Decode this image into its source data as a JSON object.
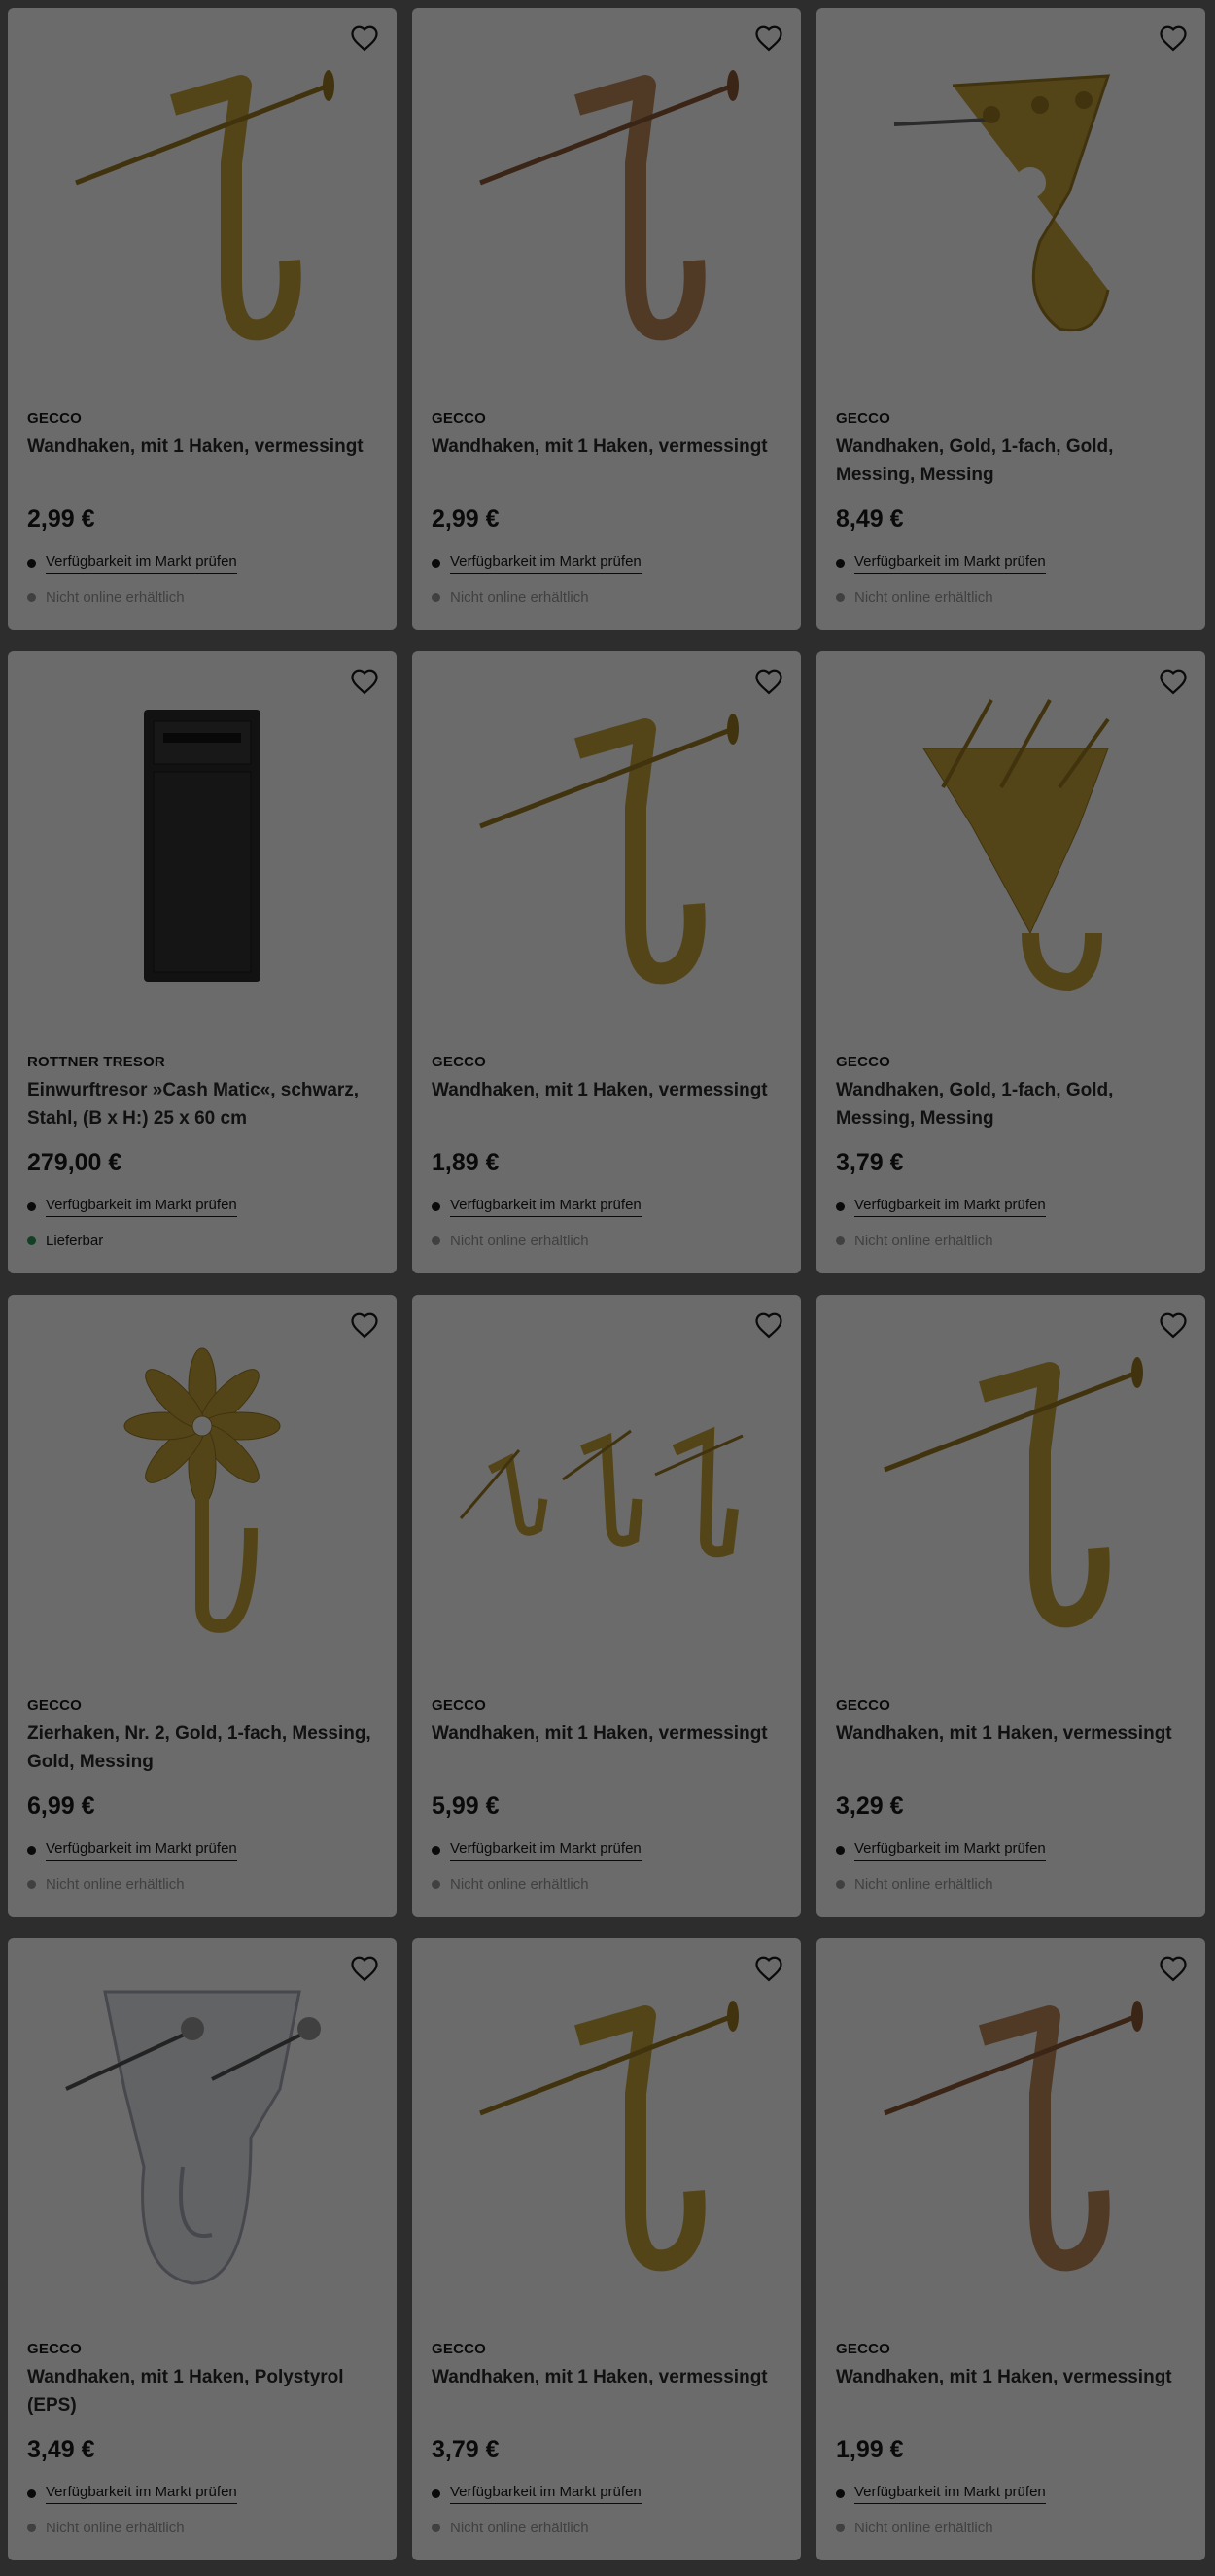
{
  "store_link_label": "Verfügbarkeit im Markt prüfen",
  "colors": {
    "unavailable": "#9a9a9a",
    "available": "#2e9a5a"
  },
  "products": [
    {
      "brand": "GECCO",
      "title": "Wandhaken, mit 1 Haken, vermessingt",
      "price": "2,99 €",
      "online": "Nicht online erhältlich",
      "available": false,
      "image": "hook-nail-brass"
    },
    {
      "brand": "GECCO",
      "title": "Wandhaken, mit 1 Haken, vermessingt",
      "price": "2,99 €",
      "online": "Nicht online erhältlich",
      "available": false,
      "image": "hook-nail-copper"
    },
    {
      "brand": "GECCO",
      "title": "Wandhaken, Gold, 1-fach, Gold, Messing, Messing",
      "price": "8,49 €",
      "online": "Nicht online erhältlich",
      "available": false,
      "image": "hook-plate-gold"
    },
    {
      "brand": "ROTTNER TRESOR",
      "title": "Einwurftresor »Cash Matic«, schwarz, Stahl, (B x H:) 25 x 60 cm",
      "price": "279,00 €",
      "online": "Lieferbar",
      "available": true,
      "image": "safe-black"
    },
    {
      "brand": "GECCO",
      "title": "Wandhaken, mit 1 Haken, vermessingt",
      "price": "1,89 €",
      "online": "Nicht online erhältlich",
      "available": false,
      "image": "hook-nail-brass"
    },
    {
      "brand": "GECCO",
      "title": "Wandhaken, Gold, 1-fach, Gold, Messing, Messing",
      "price": "3,79 €",
      "online": "Nicht online erhältlich",
      "available": false,
      "image": "hook-triple-nail"
    },
    {
      "brand": "GECCO",
      "title": "Zierhaken, Nr. 2, Gold, 1-fach, Messing, Gold, Messing",
      "price": "6,99 €",
      "online": "Nicht online erhältlich",
      "available": false,
      "image": "hook-flower"
    },
    {
      "brand": "GECCO",
      "title": "Wandhaken, mit 1 Haken, vermessingt",
      "price": "5,99 €",
      "online": "Nicht online erhältlich",
      "available": false,
      "image": "hook-set-three"
    },
    {
      "brand": "GECCO",
      "title": "Wandhaken, mit 1 Haken, vermessingt",
      "price": "3,29 €",
      "online": "Nicht online erhältlich",
      "available": false,
      "image": "hook-nail-brass"
    },
    {
      "brand": "GECCO",
      "title": "Wandhaken, mit 1 Haken, Polystyrol (EPS)",
      "price": "3,49 €",
      "online": "Nicht online erhältlich",
      "available": false,
      "image": "hook-clear-plastic"
    },
    {
      "brand": "GECCO",
      "title": "Wandhaken, mit 1 Haken, vermessingt",
      "price": "3,79 €",
      "online": "Nicht online erhältlich",
      "available": false,
      "image": "hook-nail-brass"
    },
    {
      "brand": "GECCO",
      "title": "Wandhaken, mit 1 Haken, vermessingt",
      "price": "1,99 €",
      "online": "Nicht online erhältlich",
      "available": false,
      "image": "hook-nail-copper"
    }
  ]
}
